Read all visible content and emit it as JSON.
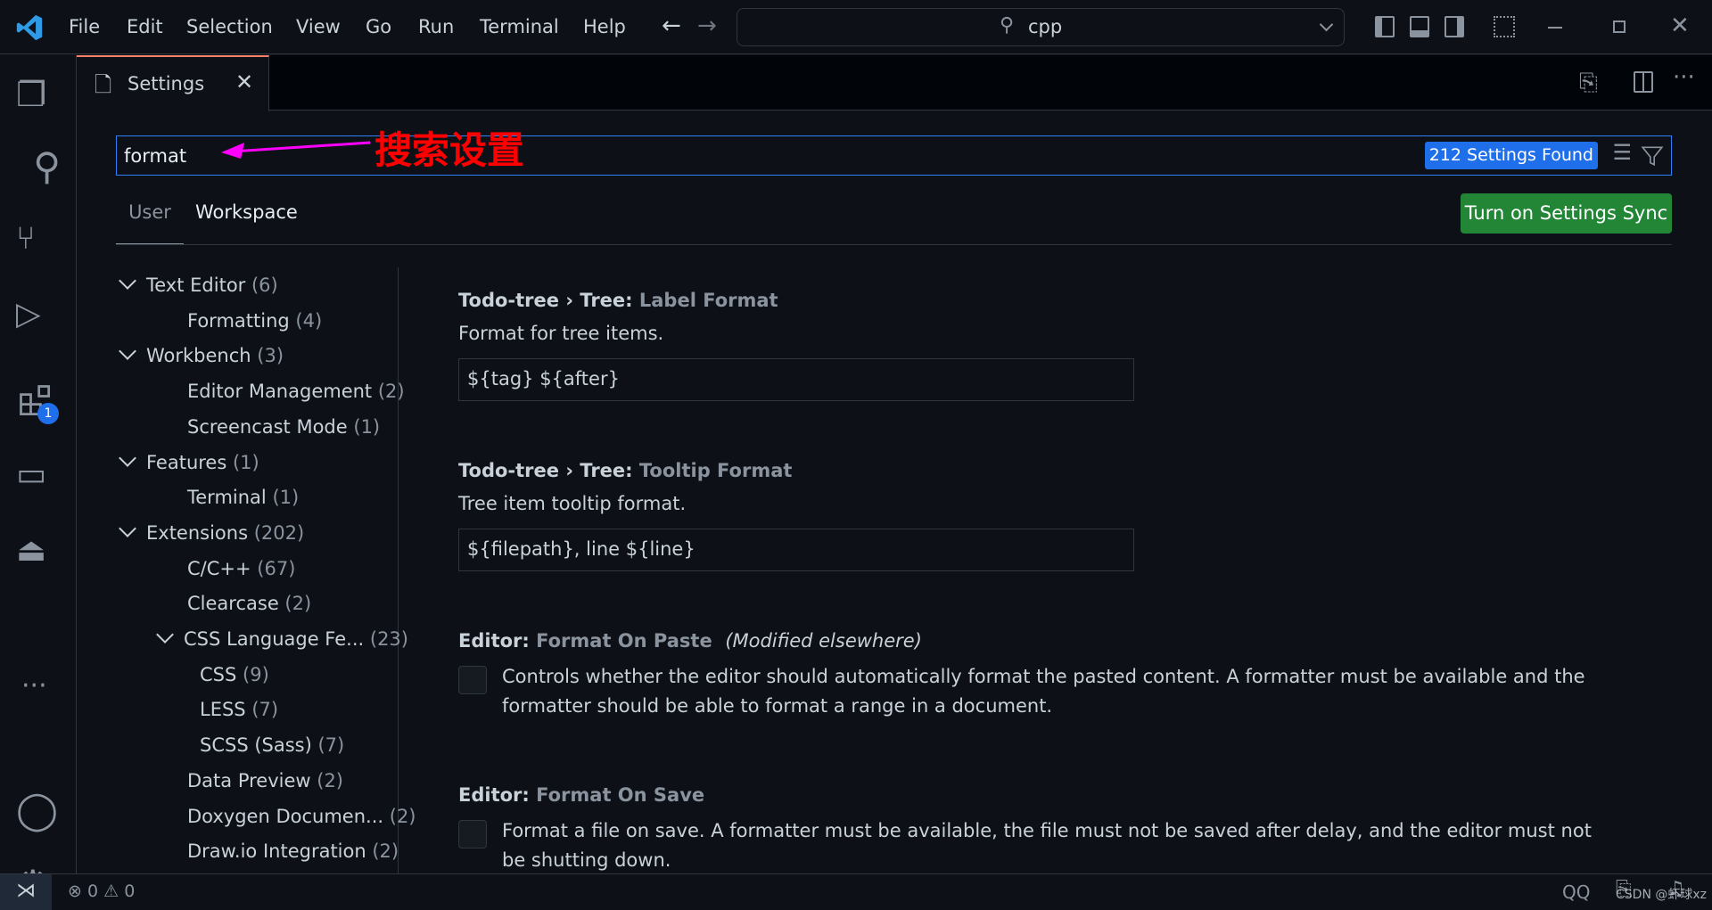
{
  "menu": [
    "File",
    "Edit",
    "Selection",
    "View",
    "Go",
    "Run",
    "Terminal",
    "Help"
  ],
  "command_center": {
    "text": "cpp"
  },
  "tab": {
    "label": "Settings"
  },
  "search": {
    "value": "format",
    "results": "212 Settings Found"
  },
  "annotation": {
    "text": "搜索设置",
    "color": "#ff00ff",
    "text_color": "#ff0000"
  },
  "scope_tabs": [
    {
      "label": "User",
      "active": true
    },
    {
      "label": "Workspace",
      "active": false
    }
  ],
  "sync_button": "Turn on Settings Sync",
  "extensions_badge": "1",
  "toc": [
    {
      "label": "Text Editor",
      "count": "(6)",
      "level": 0,
      "expanded": true
    },
    {
      "label": "Formatting",
      "count": "(4)",
      "level": 1
    },
    {
      "label": "Workbench",
      "count": "(3)",
      "level": 0,
      "expanded": true
    },
    {
      "label": "Editor Management",
      "count": "(2)",
      "level": 1
    },
    {
      "label": "Screencast Mode",
      "count": "(1)",
      "level": 1
    },
    {
      "label": "Features",
      "count": "(1)",
      "level": 0,
      "expanded": true
    },
    {
      "label": "Terminal",
      "count": "(1)",
      "level": 1
    },
    {
      "label": "Extensions",
      "count": "(202)",
      "level": 0,
      "expanded": true
    },
    {
      "label": "C/C++",
      "count": "(67)",
      "level": 1
    },
    {
      "label": "Clearcase",
      "count": "(2)",
      "level": 1
    },
    {
      "label": "CSS Language Fe...",
      "count": "(23)",
      "level": 1,
      "expanded": true
    },
    {
      "label": "CSS",
      "count": "(9)",
      "level": 2
    },
    {
      "label": "LESS",
      "count": "(7)",
      "level": 2
    },
    {
      "label": "SCSS (Sass)",
      "count": "(7)",
      "level": 2
    },
    {
      "label": "Data Preview",
      "count": "(2)",
      "level": 1
    },
    {
      "label": "Doxygen Documen...",
      "count": "(2)",
      "level": 1
    },
    {
      "label": "Draw.io Integration",
      "count": "(2)",
      "level": 1
    }
  ],
  "settings": [
    {
      "category": "Todo-tree › Tree: ",
      "name": "Label Format",
      "description": "Format for tree items.",
      "value": "${tag} ${after}"
    },
    {
      "category": "Todo-tree › Tree: ",
      "name": "Tooltip Format",
      "description": "Tree item tooltip format.",
      "value": "${filepath}, line ${line}"
    },
    {
      "category": "Editor: ",
      "name": "Format On Paste",
      "modified": "(Modified elsewhere)",
      "description": "Controls whether the editor should automatically format the pasted content. A formatter must be available and the formatter should be able to format a range in a document.",
      "checked": false
    },
    {
      "category": "Editor: ",
      "name": "Format On Save",
      "description": "Format a file on save. A formatter must be available, the file must not be saved after delay, and the editor must not be shutting down.",
      "checked": false
    }
  ],
  "status": {
    "errors": "0",
    "warnings": "0",
    "qq": "QQ",
    "watermark": "CSDN @虾球xz"
  }
}
